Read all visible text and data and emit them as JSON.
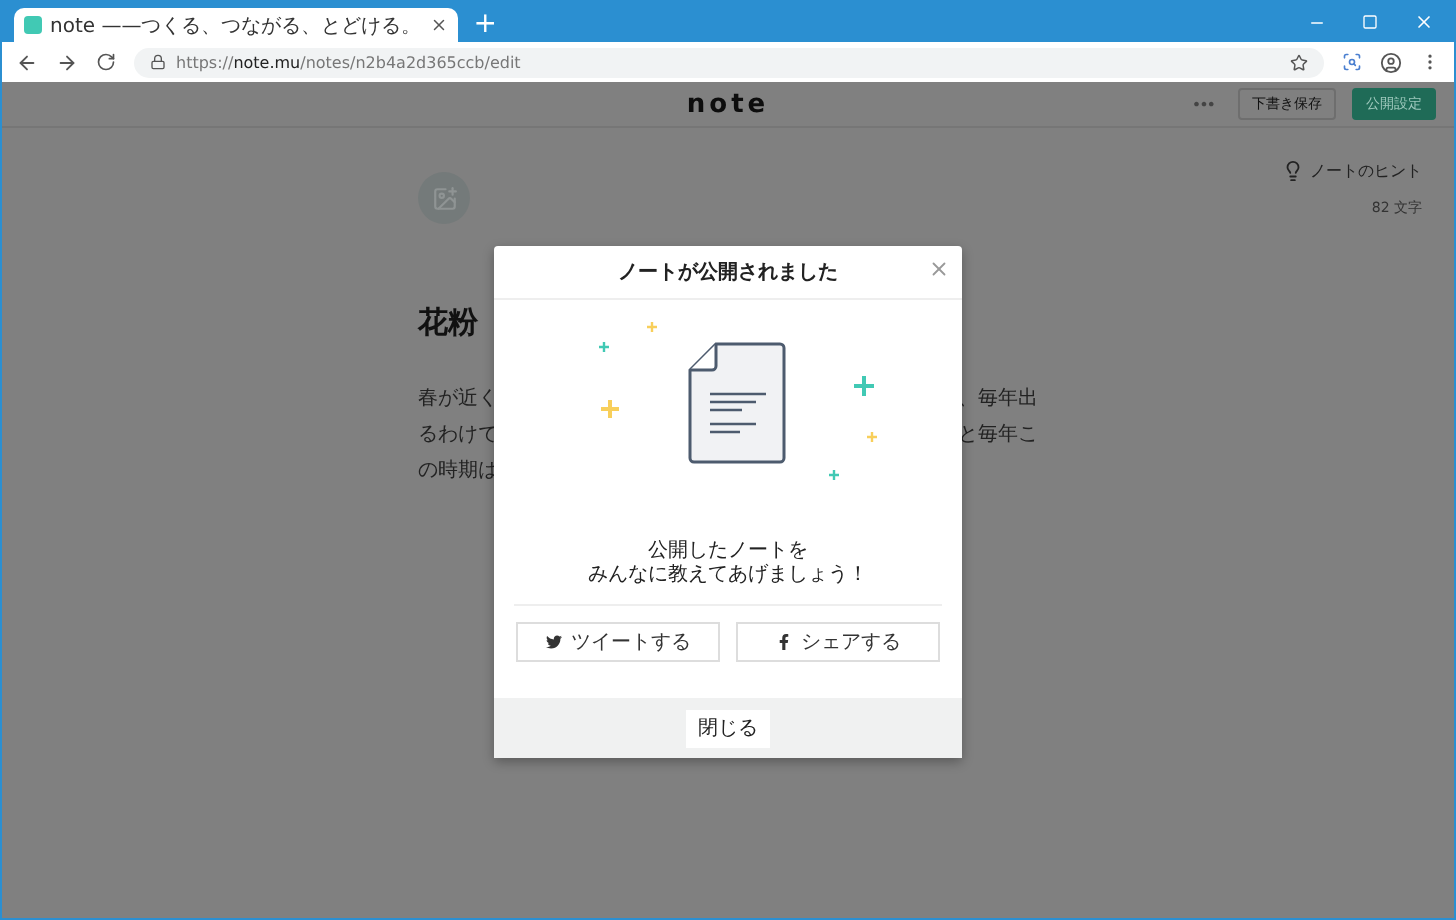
{
  "browser": {
    "tab": {
      "title": "note ——つくる、つながる、とどける。",
      "selected": true
    },
    "new_tab": "+",
    "address": {
      "scheme": "https://",
      "host": "note.mu",
      "path": "/notes/n2b4a2d365ccb/edit"
    }
  },
  "header": {
    "logo": "note",
    "more": "•••",
    "buttons": [
      {
        "label": "下書き保存",
        "kind": "outline"
      },
      {
        "label": "公開設定",
        "kind": "primary"
      }
    ]
  },
  "sidebar": {
    "hint": "ノートのヒント",
    "count": "82 文字"
  },
  "editor": {
    "title": "花粉",
    "lines": [
      {
        "left": "春が近く",
        "right": "、毎年出"
      },
      {
        "left": "るわけで",
        "right": "と毎年こ"
      },
      {
        "left": "の時期は"
      }
    ]
  },
  "dialog": {
    "title": "ノートが公開されました",
    "message": [
      "公開したノートを",
      "みんなに教えてあげましょう！"
    ],
    "share_buttons": [
      {
        "label": "ツイートする",
        "kind": "twitter"
      },
      {
        "label": "シェアする",
        "kind": "facebook"
      }
    ],
    "close_button": "閉じる"
  }
}
